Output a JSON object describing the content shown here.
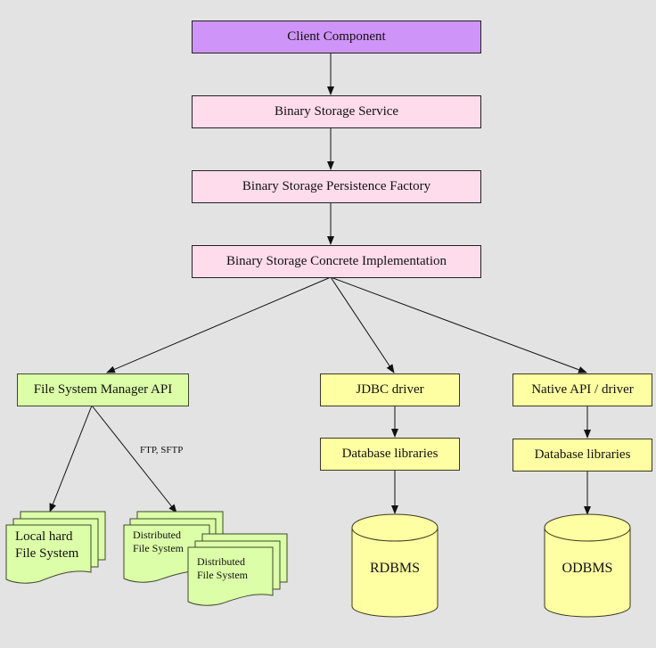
{
  "diagram": {
    "colors": {
      "background": "#e3e3e3",
      "client": "#cf94f7",
      "service_layer": "#ffdcec",
      "file_system": "#dcfea8",
      "database": "#fefea2",
      "line": "#111111"
    },
    "nodes": {
      "client_component": "Client Component",
      "binary_storage_service": "Binary Storage Service",
      "persistence_factory": "Binary Storage Persistence Factory",
      "concrete_implementation": "Binary Storage Concrete Implementation",
      "file_system_manager_api": "File System Manager API",
      "jdbc_driver": "JDBC driver",
      "native_api_driver": "Native API / driver",
      "database_libraries_left": "Database libraries",
      "database_libraries_right": "Database libraries",
      "local_fs_line1": "Local hard",
      "local_fs_line2": "File System",
      "distributed_fs_a_line1": "Distributed",
      "distributed_fs_a_line2": "File System",
      "distributed_fs_b_line1": "Distributed",
      "distributed_fs_b_line2": "File System",
      "rdbms": "RDBMS",
      "odbms": "ODBMS"
    },
    "edge_labels": {
      "ftp_sftp": "FTP, SFTP"
    },
    "edges": [
      [
        "Client Component",
        "Binary Storage Service"
      ],
      [
        "Binary Storage Service",
        "Binary Storage Persistence Factory"
      ],
      [
        "Binary Storage Persistence Factory",
        "Binary Storage Concrete Implementation"
      ],
      [
        "Binary Storage Concrete Implementation",
        "File System Manager API"
      ],
      [
        "Binary Storage Concrete Implementation",
        "JDBC driver"
      ],
      [
        "Binary Storage Concrete Implementation",
        "Native API / driver"
      ],
      [
        "File System Manager API",
        "Local hard File System"
      ],
      [
        "File System Manager API",
        "Distributed File System"
      ],
      [
        "JDBC driver",
        "Database libraries"
      ],
      [
        "Native API / driver",
        "Database libraries"
      ],
      [
        "Database libraries",
        "RDBMS"
      ],
      [
        "Database libraries",
        "ODBMS"
      ]
    ]
  }
}
